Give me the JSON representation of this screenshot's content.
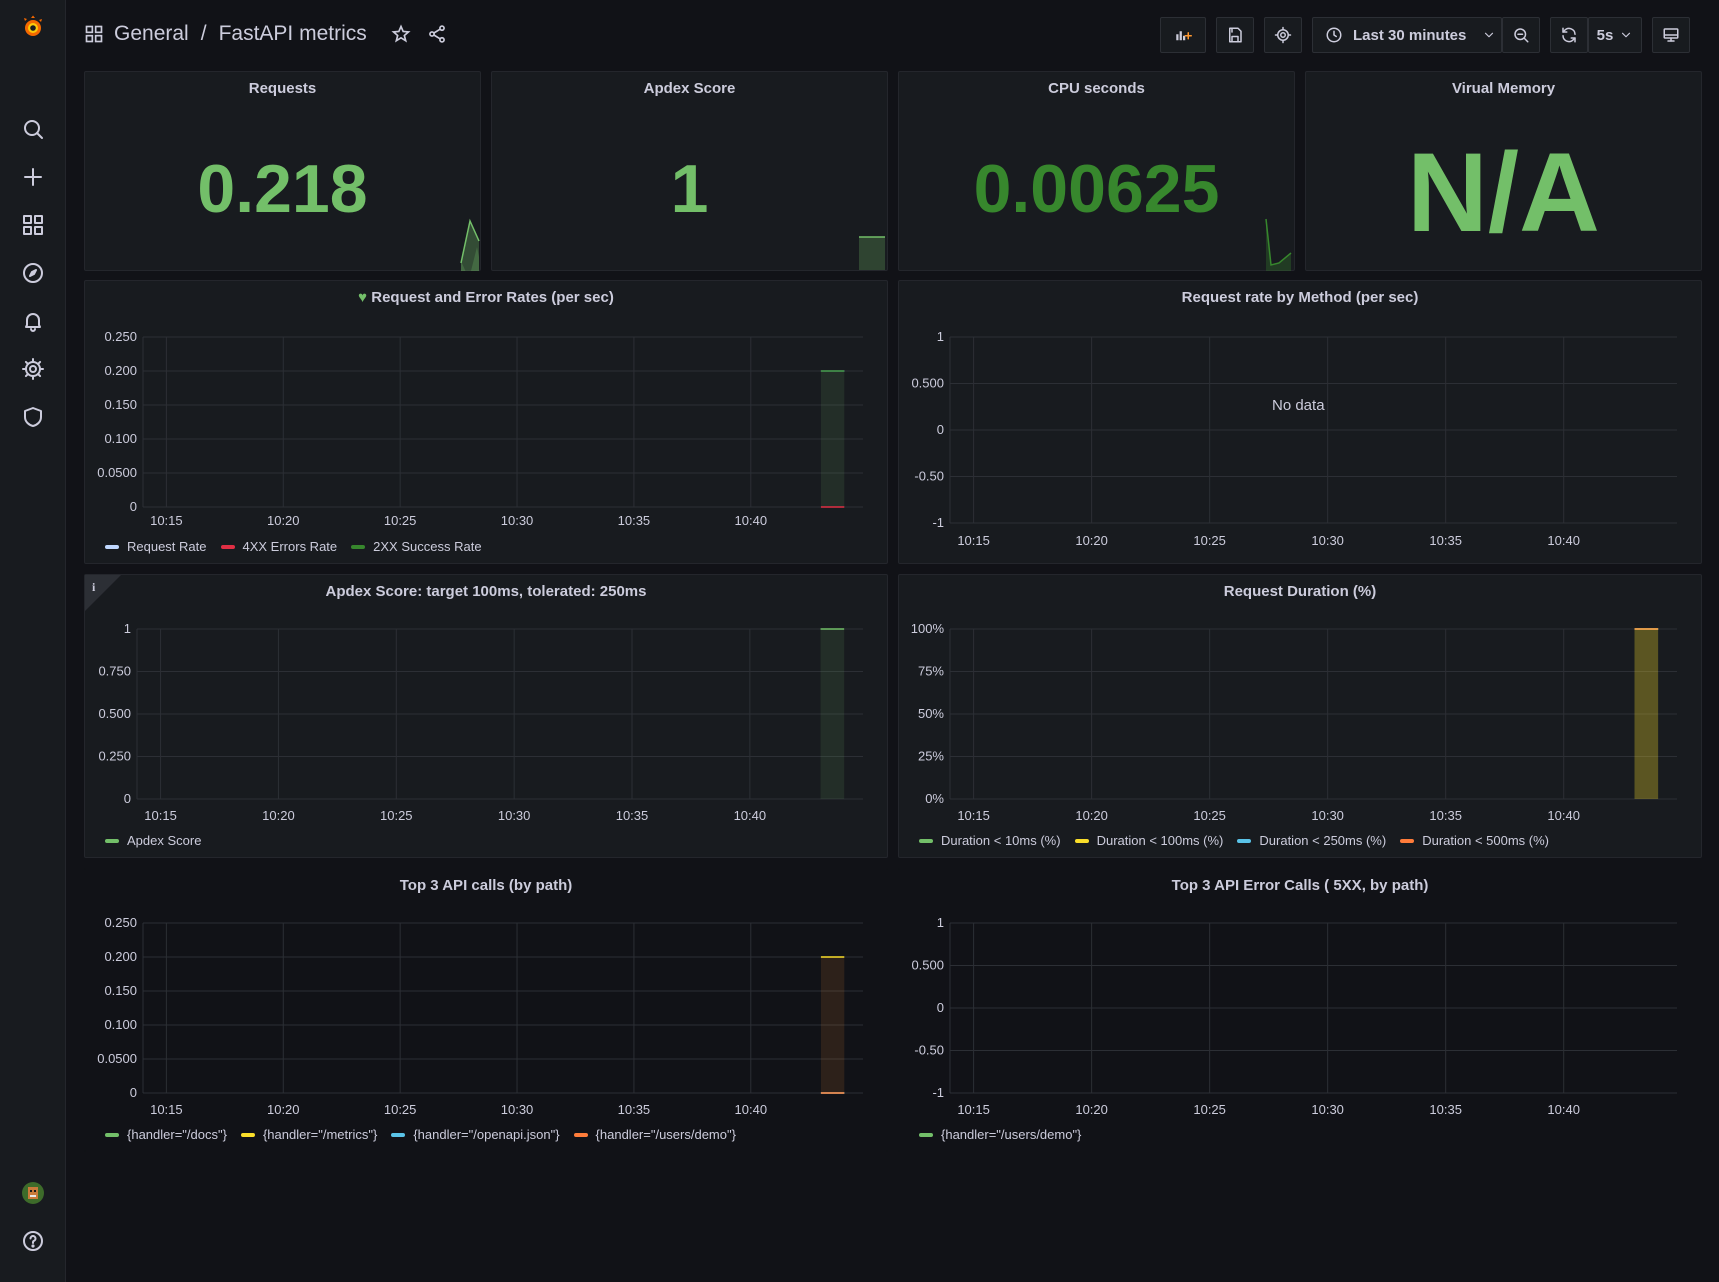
{
  "breadcrumb": {
    "folder": "General",
    "separator": "/",
    "dashboard": "FastAPI metrics"
  },
  "toolbar": {
    "time_range": "Last 30 minutes",
    "refresh_interval": "5s"
  },
  "colors": {
    "green": "#73bf69",
    "darkgreen": "#37872d",
    "red": "#e02f44",
    "blue": "#8ab8ff",
    "yellow": "#fade2a",
    "orange": "#ff9830",
    "cyan": "#5794f2",
    "lightblue": "#8ab8ff"
  },
  "stats": [
    {
      "title": "Requests",
      "value": "0.218"
    },
    {
      "title": "Apdex Score",
      "value": "1"
    },
    {
      "title": "CPU seconds",
      "value": "0.00625"
    },
    {
      "title": "Virual Memory",
      "value": "N/A"
    }
  ],
  "panels": {
    "req_err": {
      "title": "Request and Error Rates (per sec)",
      "legend": [
        "Request Rate",
        "4XX Errors Rate",
        "2XX Success Rate"
      ]
    },
    "by_method": {
      "title": "Request rate by Method (per sec)",
      "no_data": "No data"
    },
    "apdex": {
      "title": "Apdex Score: target 100ms, tolerated: 250ms",
      "info": "i",
      "legend": [
        "Apdex Score"
      ]
    },
    "duration": {
      "title": "Request Duration (%)",
      "legend": [
        "Duration < 10ms (%)",
        "Duration < 100ms (%)",
        "Duration < 250ms (%)",
        "Duration < 500ms (%)"
      ]
    },
    "top3": {
      "title": "Top 3 API calls (by path)",
      "legend": [
        "{handler=\"/docs\"}",
        "{handler=\"/metrics\"}",
        "{handler=\"/openapi.json\"}",
        "{handler=\"/users/demo\"}"
      ]
    },
    "top3err": {
      "title": "Top 3 API Error Calls ( 5XX, by path)",
      "legend": [
        "{handler=\"/users/demo\"}"
      ]
    }
  },
  "chart_data": [
    {
      "type": "line",
      "title": "Request and Error Rates (per sec)",
      "x_ticks": [
        "10:15",
        "10:20",
        "10:25",
        "10:30",
        "10:35",
        "10:40"
      ],
      "y_ticks": [
        "0",
        "0.0500",
        "0.100",
        "0.150",
        "0.200",
        "0.250"
      ],
      "ylim": [
        0,
        0.25
      ],
      "series": [
        {
          "name": "Request Rate",
          "x": [
            "10:43",
            "10:44"
          ],
          "values": [
            0.2,
            0.2
          ]
        },
        {
          "name": "4XX Errors Rate",
          "x": [
            "10:43",
            "10:44"
          ],
          "values": [
            0,
            0
          ]
        },
        {
          "name": "2XX Success Rate",
          "x": [
            "10:43",
            "10:44"
          ],
          "values": [
            0.2,
            0.2
          ]
        }
      ]
    },
    {
      "type": "line",
      "title": "Request rate by Method (per sec)",
      "x_ticks": [
        "10:15",
        "10:20",
        "10:25",
        "10:30",
        "10:35",
        "10:40"
      ],
      "y_ticks": [
        "-1",
        "-0.50",
        "0",
        "0.500",
        "1"
      ],
      "ylim": [
        -1,
        1
      ],
      "series": []
    },
    {
      "type": "line",
      "title": "Apdex Score: target 100ms, tolerated: 250ms",
      "x_ticks": [
        "10:15",
        "10:20",
        "10:25",
        "10:30",
        "10:35",
        "10:40"
      ],
      "y_ticks": [
        "0",
        "0.250",
        "0.500",
        "0.750",
        "1"
      ],
      "ylim": [
        0,
        1
      ],
      "series": [
        {
          "name": "Apdex Score",
          "x": [
            "10:43",
            "10:44"
          ],
          "values": [
            1,
            1
          ]
        }
      ]
    },
    {
      "type": "area",
      "title": "Request Duration (%)",
      "x_ticks": [
        "10:15",
        "10:20",
        "10:25",
        "10:30",
        "10:35",
        "10:40"
      ],
      "y_ticks": [
        "0%",
        "25%",
        "50%",
        "75%",
        "100%"
      ],
      "ylim": [
        0,
        100
      ],
      "series": [
        {
          "name": "Duration < 10ms (%)",
          "x": [
            "10:43",
            "10:44"
          ],
          "values": [
            100,
            100
          ]
        },
        {
          "name": "Duration < 100ms (%)",
          "x": [
            "10:43",
            "10:44"
          ],
          "values": [
            100,
            100
          ]
        },
        {
          "name": "Duration < 250ms (%)",
          "x": [
            "10:43",
            "10:44"
          ],
          "values": [
            100,
            100
          ]
        },
        {
          "name": "Duration < 500ms (%)",
          "x": [
            "10:43",
            "10:44"
          ],
          "values": [
            100,
            100
          ]
        }
      ]
    },
    {
      "type": "line",
      "title": "Top 3 API calls (by path)",
      "x_ticks": [
        "10:15",
        "10:20",
        "10:25",
        "10:30",
        "10:35",
        "10:40"
      ],
      "y_ticks": [
        "0",
        "0.0500",
        "0.100",
        "0.150",
        "0.200",
        "0.250"
      ],
      "ylim": [
        0,
        0.25
      ],
      "series": [
        {
          "name": "{handler=\"/docs\"}",
          "x": [
            "10:43",
            "10:44"
          ],
          "values": [
            0,
            0
          ]
        },
        {
          "name": "{handler=\"/metrics\"}",
          "x": [
            "10:43",
            "10:44"
          ],
          "values": [
            0.2,
            0.2
          ]
        },
        {
          "name": "{handler=\"/openapi.json\"}",
          "x": [
            "10:43",
            "10:44"
          ],
          "values": [
            0,
            0
          ]
        },
        {
          "name": "{handler=\"/users/demo\"}",
          "x": [
            "10:43",
            "10:44"
          ],
          "values": [
            0,
            0
          ]
        }
      ]
    },
    {
      "type": "line",
      "title": "Top 3 API Error Calls ( 5XX, by path)",
      "x_ticks": [
        "10:15",
        "10:20",
        "10:25",
        "10:30",
        "10:35",
        "10:40"
      ],
      "y_ticks": [
        "-1",
        "-0.50",
        "0",
        "0.500",
        "1"
      ],
      "ylim": [
        -1,
        1
      ],
      "series": [
        {
          "name": "{handler=\"/users/demo\"}",
          "x": [],
          "values": []
        }
      ]
    }
  ]
}
